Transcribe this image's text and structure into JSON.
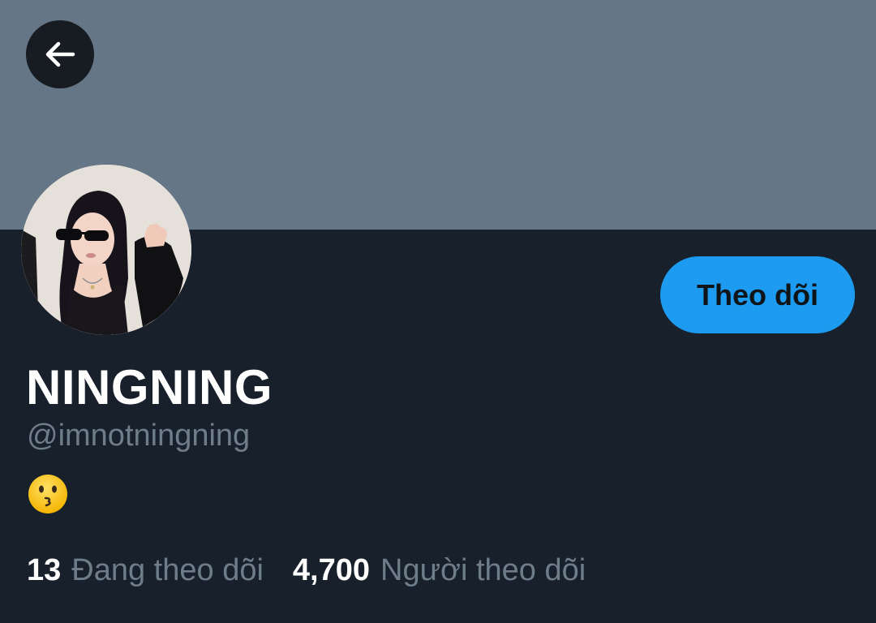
{
  "header": {
    "back_icon": "arrow-left-icon",
    "banner_color": "#657787"
  },
  "profile": {
    "display_name": "NINGNING",
    "handle": "@imnotningning",
    "bio_emoji": "😗",
    "avatar_alt": "profile-photo"
  },
  "actions": {
    "follow_label": "Theo dõi",
    "follow_color": "#1d9bf0"
  },
  "stats": {
    "following_count": "13",
    "following_label": "Đang theo dõi",
    "followers_count": "4,700",
    "followers_label": "Người theo dõi"
  }
}
